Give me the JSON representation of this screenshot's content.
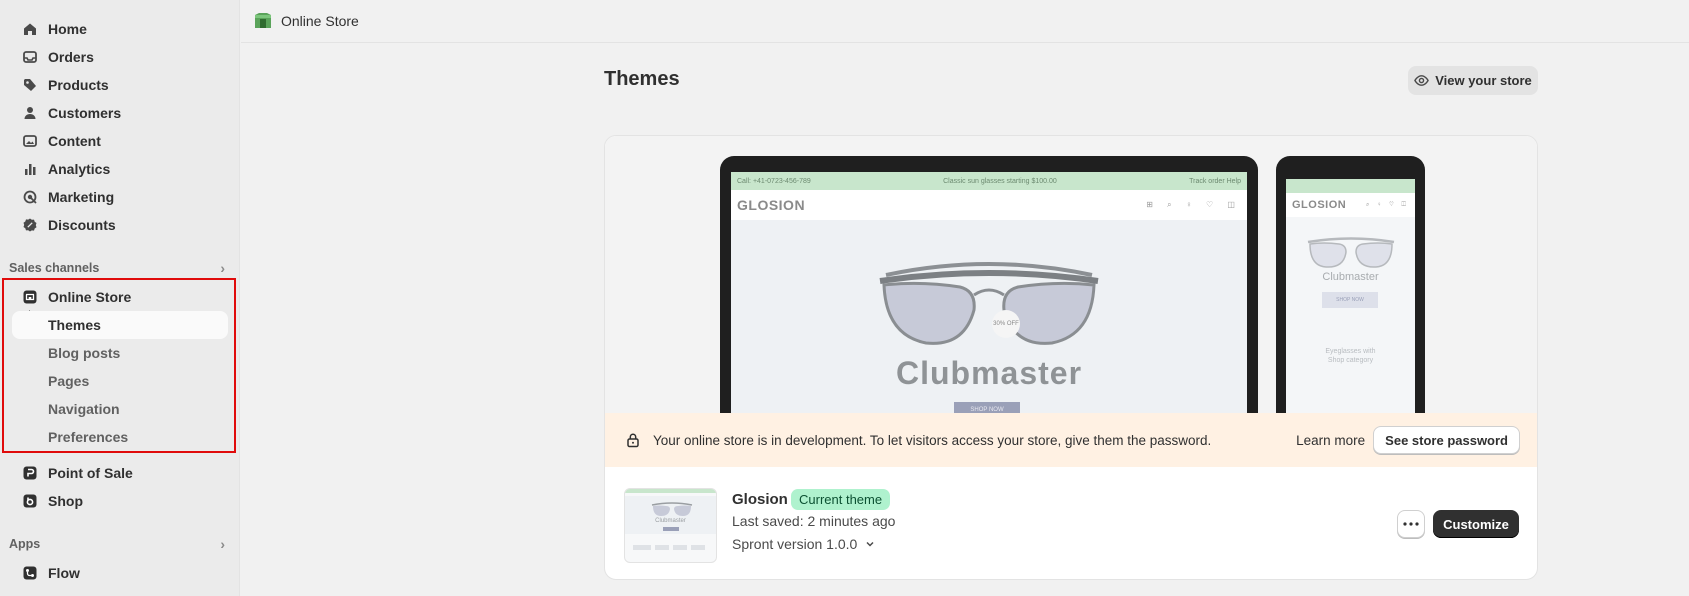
{
  "topbar": {
    "title": "Online Store"
  },
  "sidebar": {
    "main_items": [
      {
        "label": "Home",
        "icon": "home-icon"
      },
      {
        "label": "Orders",
        "icon": "inbox-icon"
      },
      {
        "label": "Products",
        "icon": "tag-icon"
      },
      {
        "label": "Customers",
        "icon": "person-icon"
      },
      {
        "label": "Content",
        "icon": "image-icon"
      },
      {
        "label": "Analytics",
        "icon": "bar-chart-icon"
      },
      {
        "label": "Marketing",
        "icon": "target-icon"
      },
      {
        "label": "Discounts",
        "icon": "discount-icon"
      }
    ],
    "sales_channels_heading": "Sales channels",
    "online_store": {
      "label": "Online Store",
      "icon": "store-icon"
    },
    "sub_items": [
      {
        "label": "Themes",
        "active": true
      },
      {
        "label": "Blog posts",
        "active": false
      },
      {
        "label": "Pages",
        "active": false
      },
      {
        "label": "Navigation",
        "active": false
      },
      {
        "label": "Preferences",
        "active": false
      }
    ],
    "other_channels": [
      {
        "label": "Point of Sale",
        "icon": "pos-icon"
      },
      {
        "label": "Shop",
        "icon": "shop-icon"
      }
    ],
    "apps_heading": "Apps",
    "apps": [
      {
        "label": "Flow",
        "icon": "flow-icon"
      }
    ]
  },
  "page": {
    "title": "Themes",
    "view_store_label": "View your store"
  },
  "preview": {
    "desktop": {
      "bar_left": "Call: +41-0723-456-789",
      "bar_center": "Classic sun glasses starting $100.00",
      "bar_right": "Track order    Help",
      "logo": "GLOSION",
      "hero_word": "Clubmaster",
      "shop_now": "SHOP NOW",
      "badge": "30% OFF"
    },
    "mobile": {
      "logo": "GLOSION",
      "hero_word": "Clubmaster",
      "shop_now": "SHOP NOW",
      "category_line1": "Eyeglasses with",
      "category_line2": "Shop category"
    }
  },
  "banner": {
    "message": "Your online store is in development. To let visitors access your store, give them the password.",
    "learn_more": "Learn more",
    "button": "See store password"
  },
  "theme": {
    "name": "Glosion",
    "badge": "Current theme",
    "last_saved": "Last saved: 2 minutes ago",
    "version": "Spront version 1.0.0",
    "thumb_word": "Clubmaster",
    "customize_label": "Customize"
  },
  "colors": {
    "highlight": "#e00b0b",
    "badge_bg": "#aff2ce",
    "banner_bg": "#fff1e3",
    "primary_btn": "#303030"
  }
}
